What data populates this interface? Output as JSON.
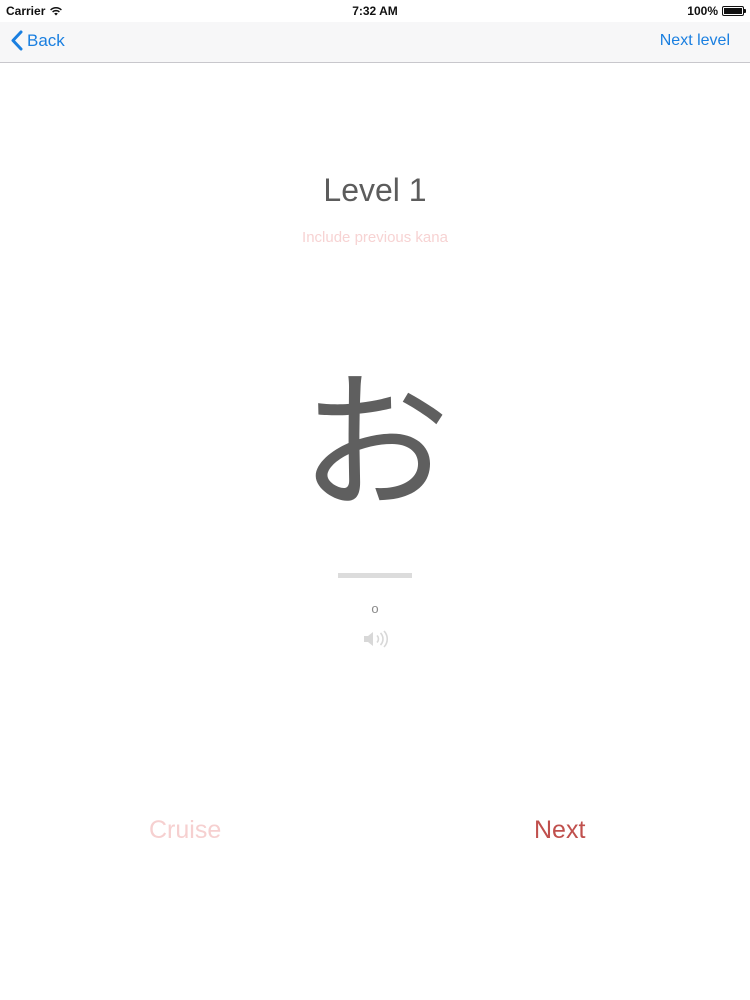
{
  "status_bar": {
    "carrier": "Carrier",
    "time": "7:32 AM",
    "battery_percent": "100%",
    "battery_level": 1.0,
    "wifi_icon": "wifi-icon",
    "battery_icon": "battery-icon"
  },
  "nav": {
    "back_label": "Back",
    "back_icon": "chevron-left-icon",
    "next_level_label": "Next level",
    "tint_color": "#1a7fe0"
  },
  "lesson": {
    "level_title": "Level 1",
    "include_previous_label": "Include previous kana",
    "kana": "お",
    "romaji": "o",
    "speaker_icon": "speaker-icon"
  },
  "actions": {
    "cruise_label": "Cruise",
    "next_label": "Next",
    "accent_color": "#c0504d"
  }
}
